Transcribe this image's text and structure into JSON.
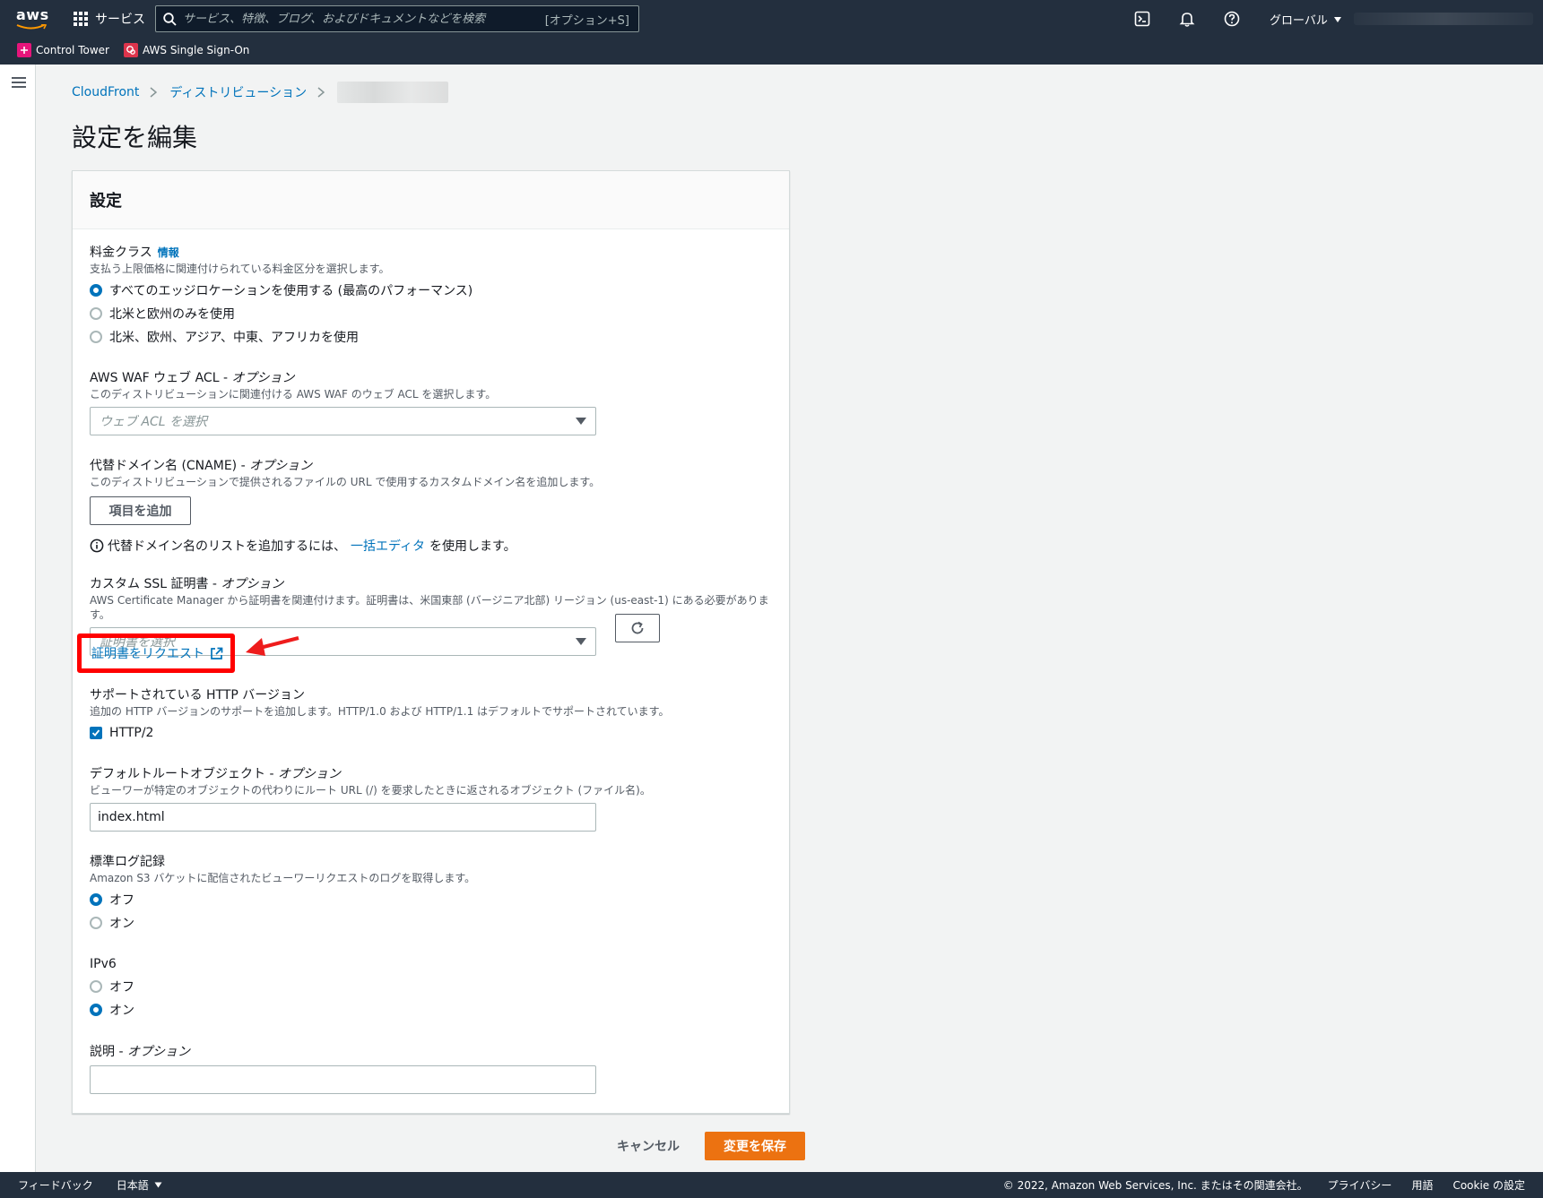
{
  "topnav": {
    "logo": "aws",
    "services": "サービス",
    "search_placeholder": "サービス、特徴、ブログ、およびドキュメントなどを検索",
    "search_shortcut": "[オプション+S]",
    "region": "グローバル",
    "favorites": [
      {
        "label": "Control Tower",
        "color": "#e7157b"
      },
      {
        "label": "AWS Single Sign-On",
        "color": "#dd344c"
      }
    ]
  },
  "breadcrumb": {
    "items": [
      "CloudFront",
      "ディストリビューション"
    ]
  },
  "page": {
    "title": "設定を編集"
  },
  "panel": {
    "title": "設定",
    "price_class": {
      "label": "料金クラス",
      "info": "情報",
      "desc": "支払う上限価格に関連付けられている料金区分を選択します。",
      "options": [
        "すべてのエッジロケーションを使用する (最高のパフォーマンス)",
        "北米と欧州のみを使用",
        "北米、欧州、アジア、中東、アフリカを使用"
      ],
      "selected": 0
    },
    "waf": {
      "label": "AWS WAF ウェブ ACL",
      "optional": "オプション",
      "desc": "このディストリビューションに関連付ける AWS WAF のウェブ ACL を選択します。",
      "placeholder": "ウェブ ACL を選択"
    },
    "cname": {
      "label": "代替ドメイン名 (CNAME)",
      "optional": "オプション",
      "desc": "このディストリビューションで提供されるファイルの URL で使用するカスタムドメイン名を追加します。",
      "add_button": "項目を追加",
      "note_before": "代替ドメイン名のリストを追加するには、",
      "note_link": "一括エディタ",
      "note_after": "を使用します。"
    },
    "ssl": {
      "label": "カスタム SSL 証明書",
      "optional": "オプション",
      "desc": "AWS Certificate Manager から証明書を関連付けます。証明書は、米国東部 (バージニア北部) リージョン (us-east-1) にある必要があります。",
      "placeholder": "証明書を選択",
      "request_link": "証明書をリクエスト"
    },
    "http": {
      "label": "サポートされている HTTP バージョン",
      "desc": "追加の HTTP バージョンのサポートを追加します。HTTP/1.0 および HTTP/1.1 はデフォルトでサポートされています。",
      "option": "HTTP/2",
      "checked": true
    },
    "root_object": {
      "label": "デフォルトルートオブジェクト",
      "optional": "オプション",
      "desc": "ビューワーが特定のオブジェクトの代わりにルート URL (/) を要求したときに返されるオブジェクト (ファイル名)。",
      "value": "index.html"
    },
    "logging": {
      "label": "標準ログ記録",
      "desc": "Amazon S3 バケットに配信されたビューワーリクエストのログを取得します。",
      "options": [
        "オフ",
        "オン"
      ],
      "selected": 0
    },
    "ipv6": {
      "label": "IPv6",
      "options": [
        "オフ",
        "オン"
      ],
      "selected": 1
    },
    "description": {
      "label": "説明",
      "optional": "オプション",
      "value": ""
    }
  },
  "actions": {
    "cancel": "キャンセル",
    "save": "変更を保存"
  },
  "footer": {
    "feedback": "フィードバック",
    "language": "日本語",
    "copyright": "© 2022, Amazon Web Services, Inc. またはその関連会社。",
    "privacy": "プライバシー",
    "terms": "用語",
    "cookie": "Cookie の設定"
  }
}
